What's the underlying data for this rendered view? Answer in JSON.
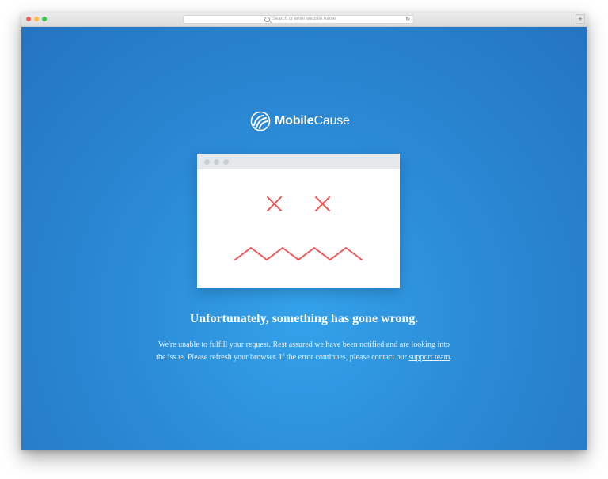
{
  "browser": {
    "url_placeholder": "Search or enter website name",
    "reload_glyph": "↻",
    "new_tab_glyph": "+"
  },
  "brand": {
    "name_bold": "Mobile",
    "name_light": "Cause",
    "logo_icon": "mobilecause-swirl-icon"
  },
  "illustration": {
    "icon": "sad-browser-window-icon",
    "accent_color": "#f0585a"
  },
  "error": {
    "headline": "Unfortunately, something has gone wrong.",
    "message_before_link": "We're unable to fulfill your request. Rest assured we have been notified and are looking into the issue. Please refresh your browser. If the error continues, please contact our ",
    "link_text": "support team",
    "message_after_link": "."
  },
  "colors": {
    "background": "#2b8ad6",
    "text": "#ffffff"
  }
}
